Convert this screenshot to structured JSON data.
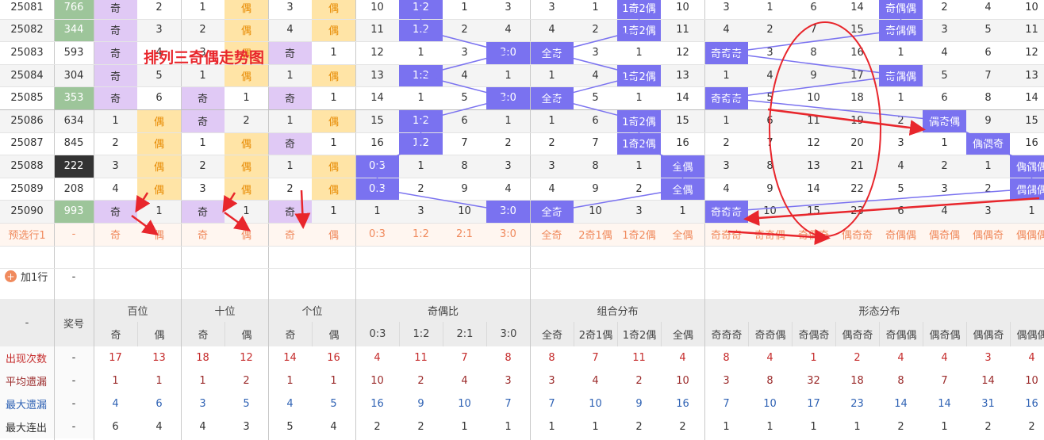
{
  "title": "排列三奇偶走势图",
  "add_row_label": "加1行",
  "add_row_value": "-",
  "rows": [
    {
      "issue": "25081",
      "num": "766",
      "numStyle": "green",
      "cells": [
        "奇",
        "2",
        "1",
        "偶",
        "3",
        "偶",
        "10",
        "1:2",
        "1",
        "3",
        "3",
        "1",
        "1奇2偶",
        "10",
        "3",
        "1",
        "6",
        "14",
        "奇偶偶",
        "2",
        "4",
        "10"
      ]
    },
    {
      "issue": "25082",
      "num": "344",
      "numStyle": "green",
      "cells": [
        "奇",
        "3",
        "2",
        "偶",
        "4",
        "偶",
        "11",
        "1:2",
        "2",
        "4",
        "4",
        "2",
        "1奇2偶",
        "11",
        "4",
        "2",
        "7",
        "15",
        "奇偶偶",
        "3",
        "5",
        "11"
      ]
    },
    {
      "issue": "25083",
      "num": "593",
      "numStyle": "",
      "cells": [
        "奇",
        "4",
        "3",
        "偶",
        "奇",
        "1",
        "12",
        "1",
        "3",
        "3:0",
        "全奇",
        "3",
        "1",
        "12",
        "奇奇奇",
        "3",
        "8",
        "16",
        "1",
        "4",
        "6",
        "12"
      ]
    },
    {
      "issue": "25084",
      "num": "304",
      "numStyle": "",
      "cells": [
        "奇",
        "5",
        "1",
        "偶",
        "1",
        "偶",
        "13",
        "1:2",
        "4",
        "1",
        "1",
        "4",
        "1奇2偶",
        "13",
        "1",
        "4",
        "9",
        "17",
        "奇偶偶",
        "5",
        "7",
        "13"
      ]
    },
    {
      "issue": "25085",
      "num": "353",
      "numStyle": "green",
      "cells": [
        "奇",
        "6",
        "奇",
        "1",
        "奇",
        "1",
        "14",
        "1",
        "5",
        "3:0",
        "全奇",
        "5",
        "1",
        "14",
        "奇奇奇",
        "5",
        "10",
        "18",
        "1",
        "6",
        "8",
        "14"
      ]
    },
    {
      "issue": "25086",
      "num": "634",
      "numStyle": "",
      "cells": [
        "1",
        "偶",
        "奇",
        "2",
        "1",
        "偶",
        "15",
        "1:2",
        "6",
        "1",
        "1",
        "6",
        "1奇2偶",
        "15",
        "1",
        "6",
        "11",
        "19",
        "2",
        "偶奇偶",
        "9",
        "15"
      ]
    },
    {
      "issue": "25087",
      "num": "845",
      "numStyle": "",
      "cells": [
        "2",
        "偶",
        "1",
        "偶",
        "奇",
        "1",
        "16",
        "1:2",
        "7",
        "2",
        "2",
        "7",
        "1奇2偶",
        "16",
        "2",
        "7",
        "12",
        "20",
        "3",
        "1",
        "偶偶奇",
        "16"
      ]
    },
    {
      "issue": "25088",
      "num": "222",
      "numStyle": "dark",
      "cells": [
        "3",
        "偶",
        "2",
        "偶",
        "1",
        "偶",
        "0:3",
        "1",
        "8",
        "3",
        "3",
        "8",
        "1",
        "全偶",
        "3",
        "8",
        "13",
        "21",
        "4",
        "2",
        "1",
        "偶偶偶"
      ]
    },
    {
      "issue": "25089",
      "num": "208",
      "numStyle": "",
      "cells": [
        "4",
        "偶",
        "3",
        "偶",
        "2",
        "偶",
        "0:3",
        "2",
        "9",
        "4",
        "4",
        "9",
        "2",
        "全偶",
        "4",
        "9",
        "14",
        "22",
        "5",
        "3",
        "2",
        "偶偶偶"
      ]
    },
    {
      "issue": "25090",
      "num": "993",
      "numStyle": "green",
      "cells": [
        "奇",
        "1",
        "奇",
        "1",
        "奇",
        "1",
        "1",
        "3",
        "10",
        "3:0",
        "全奇",
        "10",
        "3",
        "1",
        "奇奇奇",
        "10",
        "15",
        "23",
        "6",
        "4",
        "3",
        "1"
      ]
    }
  ],
  "preselect": {
    "label": "预选行1",
    "dash": "-",
    "cells": [
      "奇",
      "偶",
      "奇",
      "偶",
      "奇",
      "偶",
      "0:3",
      "1:2",
      "2:1",
      "3:0",
      "全奇",
      "2奇1偶",
      "1奇2偶",
      "全偶",
      "奇奇奇",
      "奇奇偶",
      "奇偶奇",
      "偶奇奇",
      "奇偶偶",
      "偶奇偶",
      "偶偶奇",
      "偶偶偶"
    ]
  },
  "header": {
    "blank": "-",
    "award": "奖号",
    "groups": [
      {
        "name": "百位",
        "subs": [
          "奇",
          "偶"
        ]
      },
      {
        "name": "十位",
        "subs": [
          "奇",
          "偶"
        ]
      },
      {
        "name": "个位",
        "subs": [
          "奇",
          "偶"
        ]
      },
      {
        "name": "奇偶比",
        "subs": [
          "0:3",
          "1:2",
          "2:1",
          "3:0"
        ]
      },
      {
        "name": "组合分布",
        "subs": [
          "全奇",
          "2奇1偶",
          "1奇2偶",
          "全偶"
        ]
      },
      {
        "name": "形态分布",
        "subs": [
          "奇奇奇",
          "奇奇偶",
          "奇偶奇",
          "偶奇奇",
          "奇偶偶",
          "偶奇偶",
          "偶偶奇",
          "偶偶偶"
        ]
      }
    ]
  },
  "stats": [
    {
      "label": "出现次数",
      "color": "#c52b2b",
      "dash": "-",
      "values": [
        "17",
        "13",
        "18",
        "12",
        "14",
        "16",
        "4",
        "11",
        "7",
        "8",
        "8",
        "7",
        "11",
        "4",
        "8",
        "4",
        "1",
        "2",
        "4",
        "4",
        "3",
        "4"
      ]
    },
    {
      "label": "平均遗漏",
      "color": "#9b2a2a",
      "dash": "-",
      "values": [
        "1",
        "1",
        "1",
        "2",
        "1",
        "1",
        "10",
        "2",
        "4",
        "3",
        "3",
        "4",
        "2",
        "10",
        "3",
        "8",
        "32",
        "18",
        "8",
        "7",
        "14",
        "10"
      ]
    },
    {
      "label": "最大遗漏",
      "color": "#2f62b4",
      "dash": "-",
      "values": [
        "4",
        "6",
        "3",
        "5",
        "4",
        "5",
        "16",
        "9",
        "10",
        "7",
        "7",
        "10",
        "9",
        "16",
        "7",
        "10",
        "17",
        "23",
        "14",
        "14",
        "31",
        "16"
      ]
    },
    {
      "label": "最大连出",
      "color": "#333333",
      "dash": "-",
      "values": [
        "6",
        "4",
        "4",
        "3",
        "5",
        "4",
        "2",
        "2",
        "1",
        "1",
        "1",
        "1",
        "2",
        "2",
        "1",
        "1",
        "1",
        "1",
        "2",
        "1",
        "2",
        "2"
      ]
    }
  ],
  "colors": {
    "purple": "#e0c9f5",
    "yellow": "#ffe4a6",
    "blue": "#7a72f0",
    "green": "#9dc59a",
    "annotation": "#e8262c",
    "trend_line": "#7a72f0"
  }
}
